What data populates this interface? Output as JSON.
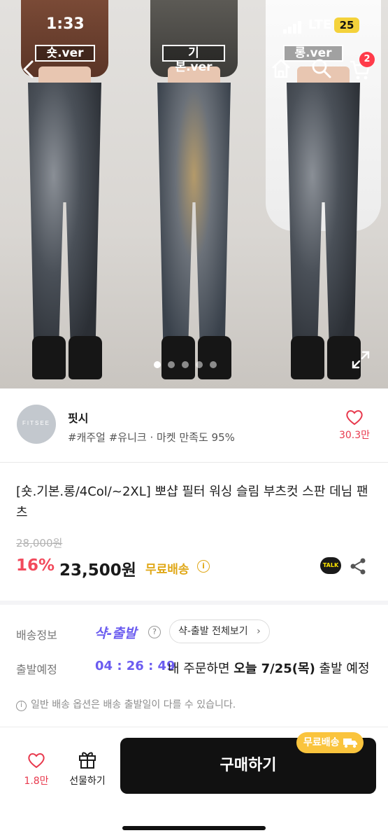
{
  "status_bar": {
    "time": "1:33",
    "network": "LTE",
    "battery": "25"
  },
  "hero": {
    "versions": [
      "숏.ver",
      "기본.ver",
      "롱.ver"
    ],
    "cart_count": "2",
    "slide_count": 5,
    "active_slide": 1
  },
  "shop": {
    "logo_text": "FITSEE",
    "name": "핏시",
    "tags": "#캐주얼 #유니크 · 마켓 만족도 95%",
    "likes": "30.3만"
  },
  "product": {
    "title": "[숏.기본.롱/4Col/~2XL] 뽀샵 필터 워싱 슬림 부츠컷 스판 데님 팬츠",
    "original_price": "28,000원",
    "discount": "16%",
    "price": "23,500원",
    "free_shipping": "무료배송",
    "talk_label": "TALK"
  },
  "delivery": {
    "label": "배송정보",
    "brand": "샥-출발",
    "see_all": "샥-출발 전체보기",
    "depart_label": "출발예정",
    "timer": "04 : 26 : 49",
    "depart_text_prefix": "내 주문하면",
    "depart_text_bold": "오늘 7/25(목)",
    "depart_text_suffix": "출발 예정",
    "notice": "일반 배송 옵션은 배송 출발일이 다를 수 있습니다."
  },
  "bottom_bar": {
    "likes": "1.8만",
    "gift_label": "선물하기",
    "buy_label": "구매하기",
    "free_badge": "무료배송"
  },
  "colors": {
    "discount": "#f24a5c",
    "free_shipping": "#e0a818",
    "syak_purple": "#6b5cf0",
    "buy_button": "#111111",
    "free_badge": "#fac43d"
  }
}
